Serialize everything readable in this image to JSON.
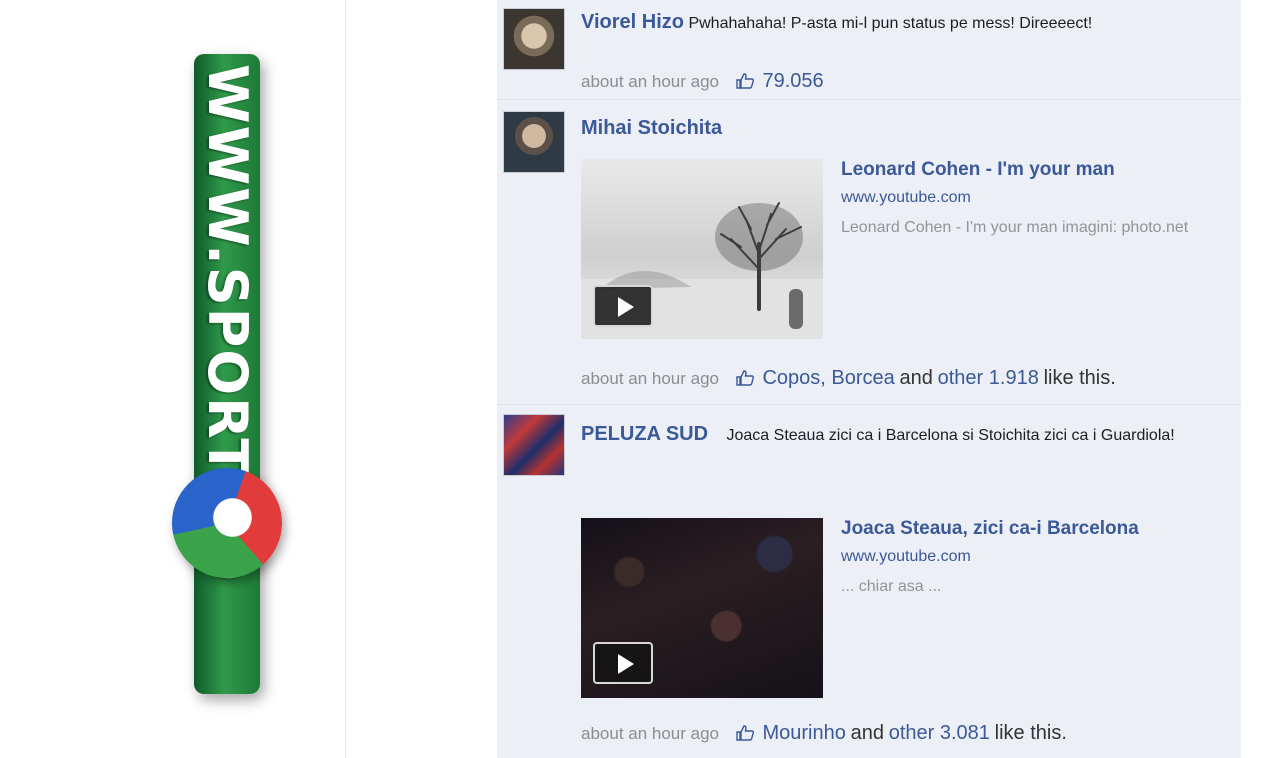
{
  "logo": {
    "text": "WWW.SPORT.RO"
  },
  "posts": [
    {
      "author": "Viorel Hizo",
      "status": "Pwhahahaha! P-asta mi-l pun status pe mess! Direeeect!",
      "time": "about an hour ago",
      "likes": "79.056"
    },
    {
      "author": "Mihai Stoichita",
      "time": "about an hour ago",
      "likers": "Copos, Borcea",
      "and": "and",
      "others": "other 1.918",
      "like_suffix": "like this.",
      "attachment": {
        "title": "Leonard Cohen - I'm your man",
        "url": "www.youtube.com",
        "description": "Leonard Cohen - I'm your man imagini: photo.net"
      }
    },
    {
      "author": "PELUZA SUD",
      "status": "Joaca Steaua zici ca i Barcelona si Stoichita zici ca i Guardiola!",
      "time": "about an hour ago",
      "likers": "Mourinho",
      "and": "and",
      "others": "other 3.081",
      "like_suffix": "like this.",
      "attachment": {
        "title": "Joaca Steaua, zici ca-i Barcelona",
        "url": "www.youtube.com",
        "description": "... chiar asa ..."
      }
    }
  ],
  "colors": {
    "link": "#3b5998",
    "feed_bg": "#eceff5",
    "logo_green": "#1d7a37"
  }
}
